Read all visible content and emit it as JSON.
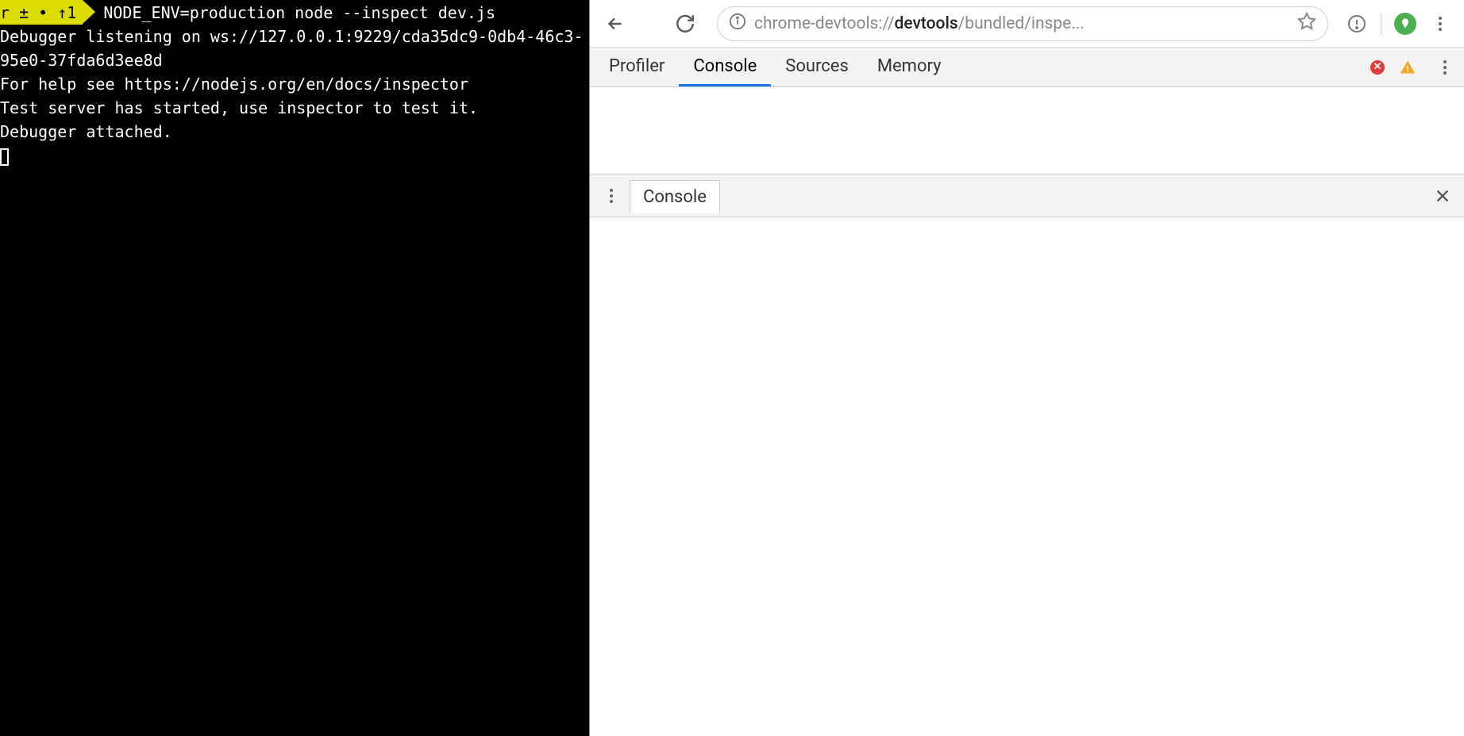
{
  "terminal": {
    "prompt_badge": "r ± • ↑1",
    "command": "NODE_ENV=production node --inspect dev.js",
    "output": "Debugger listening on ws://127.0.0.1:9229/cda35dc9-0db4-46c3-95e0-37fda6d3ee8d\nFor help see https://nodejs.org/en/docs/inspector\nTest server has started, use inspector to test it.\nDebugger attached."
  },
  "browser": {
    "address": {
      "prefix": "chrome-devtools://",
      "bold": "devtools",
      "suffix": "/bundled/inspe..."
    }
  },
  "devtools": {
    "tabs": {
      "profiler": "Profiler",
      "console": "Console",
      "sources": "Sources",
      "memory": "Memory"
    },
    "drawer": {
      "tab": "Console"
    }
  }
}
